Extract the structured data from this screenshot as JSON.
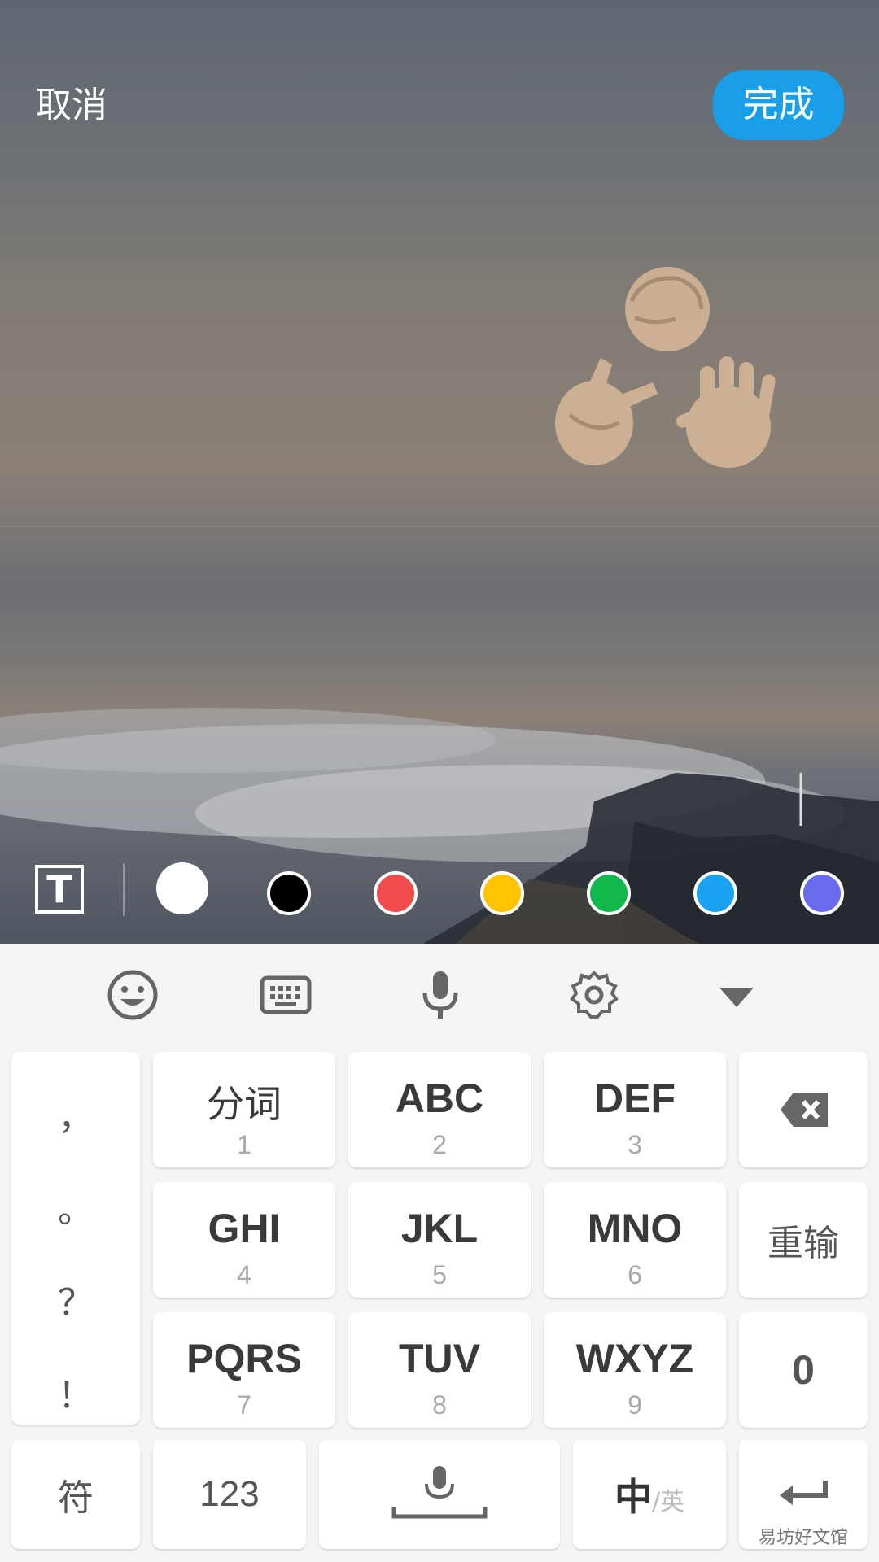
{
  "top_bar": {
    "cancel_label": "取消",
    "done_label": "完成"
  },
  "sticker": {
    "icon": "rock-paper-scissors-hands-emoji"
  },
  "tools": {
    "text_tool_label": "T",
    "colors": [
      "#ffffff",
      "#000000",
      "#f24b4b",
      "#ffc300",
      "#12b74c",
      "#1aa3f2",
      "#6b6bf0"
    ],
    "selected_color": "#ffffff"
  },
  "keyboard": {
    "toolbar_icons": [
      "emoji-icon",
      "keyboard-icon",
      "microphone-icon",
      "settings-icon",
      "hide-keyboard-icon"
    ],
    "punctuation": [
      "，",
      "。",
      "？",
      "！"
    ],
    "keys": [
      {
        "label": "分词",
        "num": "1"
      },
      {
        "label": "ABC",
        "num": "2"
      },
      {
        "label": "DEF",
        "num": "3"
      },
      {
        "label": "GHI",
        "num": "4"
      },
      {
        "label": "JKL",
        "num": "5"
      },
      {
        "label": "MNO",
        "num": "6"
      },
      {
        "label": "PQRS",
        "num": "7"
      },
      {
        "label": "TUV",
        "num": "8"
      },
      {
        "label": "WXYZ",
        "num": "9"
      }
    ],
    "reinput_label": "重输",
    "zero_label": "0",
    "symbols_label": "符",
    "numbers_label": "123",
    "lang_main": "中",
    "lang_sep": "/",
    "lang_alt": "英"
  },
  "watermark": "易坊好文馆"
}
